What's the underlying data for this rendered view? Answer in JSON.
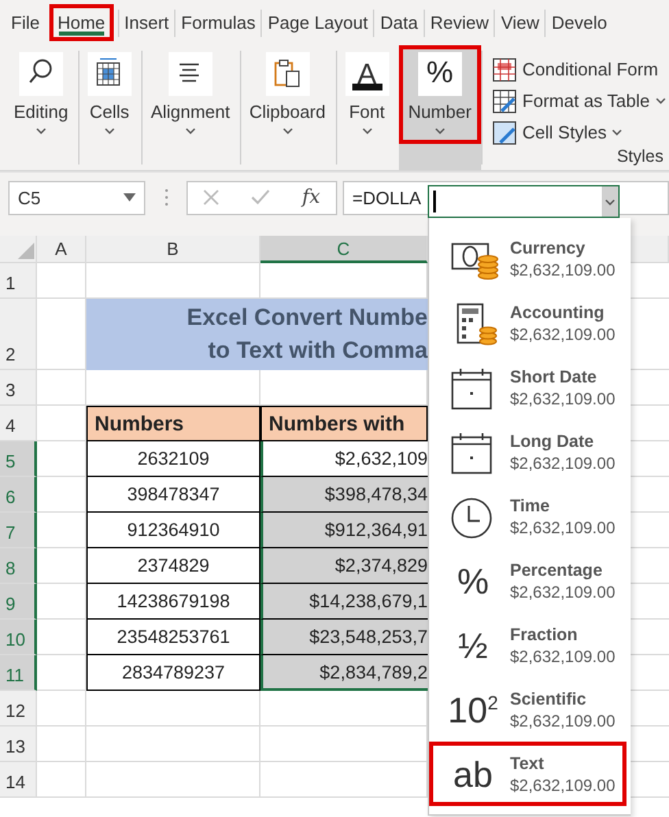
{
  "tabs": [
    {
      "label": "File",
      "selected": false,
      "highlighted": false
    },
    {
      "label": "Home",
      "selected": true,
      "highlighted": true
    },
    {
      "label": "Insert",
      "selected": false,
      "highlighted": false
    },
    {
      "label": "Formulas",
      "selected": false,
      "highlighted": false
    },
    {
      "label": "Page Layout",
      "selected": false,
      "highlighted": false
    },
    {
      "label": "Data",
      "selected": false,
      "highlighted": false
    },
    {
      "label": "Review",
      "selected": false,
      "highlighted": false
    },
    {
      "label": "View",
      "selected": false,
      "highlighted": false
    },
    {
      "label": "Develo",
      "selected": false,
      "highlighted": false
    }
  ],
  "ribbon": {
    "groups": [
      {
        "kind": "editing",
        "label": "Editing",
        "pressed": false,
        "highlighted": false
      },
      {
        "kind": "cells",
        "label": "Cells",
        "pressed": false,
        "highlighted": false
      },
      {
        "kind": "alignment",
        "label": "Alignment",
        "pressed": false,
        "highlighted": false
      },
      {
        "kind": "clipboard",
        "label": "Clipboard",
        "pressed": false,
        "highlighted": false
      },
      {
        "kind": "font",
        "label": "Font",
        "symbol": "A",
        "pressed": false,
        "highlighted": false
      },
      {
        "kind": "number",
        "label": "Number",
        "symbol": "%",
        "pressed": true,
        "highlighted": true
      }
    ],
    "styles": {
      "label": "Styles",
      "items": [
        {
          "kind": "conditional",
          "label": "Conditional Form",
          "caret": false
        },
        {
          "kind": "table",
          "label": "Format as Table",
          "caret": true
        },
        {
          "kind": "cell-styles",
          "label": "Cell Styles",
          "caret": true
        }
      ]
    }
  },
  "formula_bar": {
    "name_box": "C5",
    "function_symbol": "fx",
    "formula": "=DOLLA"
  },
  "sheet": {
    "columns": [
      {
        "label": "A",
        "selected": false
      },
      {
        "label": "B",
        "selected": false
      },
      {
        "label": "C",
        "selected": true
      }
    ],
    "rows": [
      {
        "label": "1",
        "selected": false
      },
      {
        "label": "2",
        "selected": false
      },
      {
        "label": "3",
        "selected": false
      },
      {
        "label": "4",
        "selected": false
      },
      {
        "label": "5",
        "selected": true
      },
      {
        "label": "6",
        "selected": true
      },
      {
        "label": "7",
        "selected": true
      },
      {
        "label": "8",
        "selected": true
      },
      {
        "label": "9",
        "selected": true
      },
      {
        "label": "10",
        "selected": true
      },
      {
        "label": "11",
        "selected": true
      },
      {
        "label": "12",
        "selected": false
      },
      {
        "label": "13",
        "selected": false
      },
      {
        "label": "14",
        "selected": false
      }
    ],
    "title": [
      "Excel Convert Numbe",
      "to Text with Comma"
    ],
    "table": {
      "headers": [
        "Numbers",
        "Numbers with"
      ],
      "rows": [
        {
          "number": "2632109",
          "formatted": "$2,632,109",
          "active": true
        },
        {
          "number": "398478347",
          "formatted": "$398,478,34",
          "active": false
        },
        {
          "number": "912364910",
          "formatted": "$912,364,91",
          "active": false
        },
        {
          "number": "2374829",
          "formatted": "$2,374,829",
          "active": false
        },
        {
          "number": "14238679198",
          "formatted": "$14,238,679,1",
          "active": false
        },
        {
          "number": "23548253761",
          "formatted": "$23,548,253,7",
          "active": false
        },
        {
          "number": "2834789237",
          "formatted": "$2,834,789,2",
          "active": false
        }
      ]
    }
  },
  "number_format_menu": {
    "items": [
      {
        "kind": "currency",
        "label": "Currency",
        "sample": "$2,632,109.00",
        "highlighted": false
      },
      {
        "kind": "accounting",
        "label": "Accounting",
        "sample": "$2,632,109.00",
        "highlighted": false
      },
      {
        "kind": "short-date",
        "label": "Short Date",
        "sample": "$2,632,109.00",
        "highlighted": false
      },
      {
        "kind": "long-date",
        "label": "Long Date",
        "sample": "$2,632,109.00",
        "highlighted": false
      },
      {
        "kind": "time",
        "label": "Time",
        "sample": "$2,632,109.00",
        "highlighted": false
      },
      {
        "kind": "percentage",
        "label": "Percentage",
        "symbol": "%",
        "sample": "$2,632,109.00",
        "highlighted": false
      },
      {
        "kind": "fraction",
        "label": "Fraction",
        "symbol": "½",
        "sample": "$2,632,109.00",
        "highlighted": false
      },
      {
        "kind": "scientific",
        "label": "Scientific",
        "symbol": "10$^{2}$",
        "sample": "$2,632,109.00",
        "highlighted": false
      },
      {
        "kind": "text",
        "label": "Text",
        "symbol": "ab",
        "sample": "$2,632,109.00",
        "highlighted": true
      }
    ]
  }
}
